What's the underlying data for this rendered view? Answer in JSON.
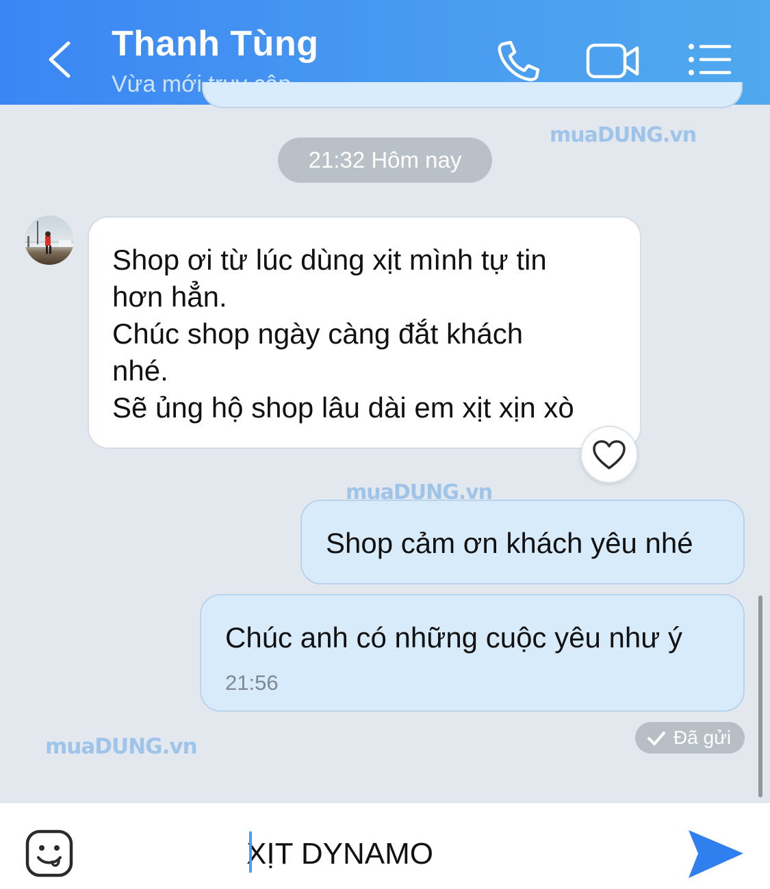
{
  "header": {
    "contact_name": "Thanh Tùng",
    "status": "Vừa mới truy cập",
    "icons": [
      "back-chevron-icon",
      "phone-icon",
      "video-icon",
      "menu-list-icon"
    ]
  },
  "watermark": "muaDUNG.vn",
  "conversation": {
    "time_divider": "21:32 Hôm nay",
    "incoming": {
      "lines": [
        "Shop ơi từ lúc dùng xịt mình tự tin",
        "hơn hẳn.",
        "Chúc shop ngày càng đắt khách",
        "nhé.",
        "Sẽ ủng hộ shop lâu dài em xịt xịn xò"
      ]
    },
    "outgoing": [
      {
        "text": "Shop cảm ơn khách yêu nhé"
      },
      {
        "text": "Chúc anh có những cuộc yêu như ý",
        "time": "21:56"
      }
    ],
    "sent_status": "Đã gửi"
  },
  "input": {
    "value": "XỊT DYNAMO"
  },
  "colors": {
    "header_start": "#3a86f4",
    "header_end": "#4fa9ee",
    "chat_bg": "#e3e8ef",
    "outgoing_bubble": "#d7ebfa",
    "send_accent": "#2f80ee"
  }
}
